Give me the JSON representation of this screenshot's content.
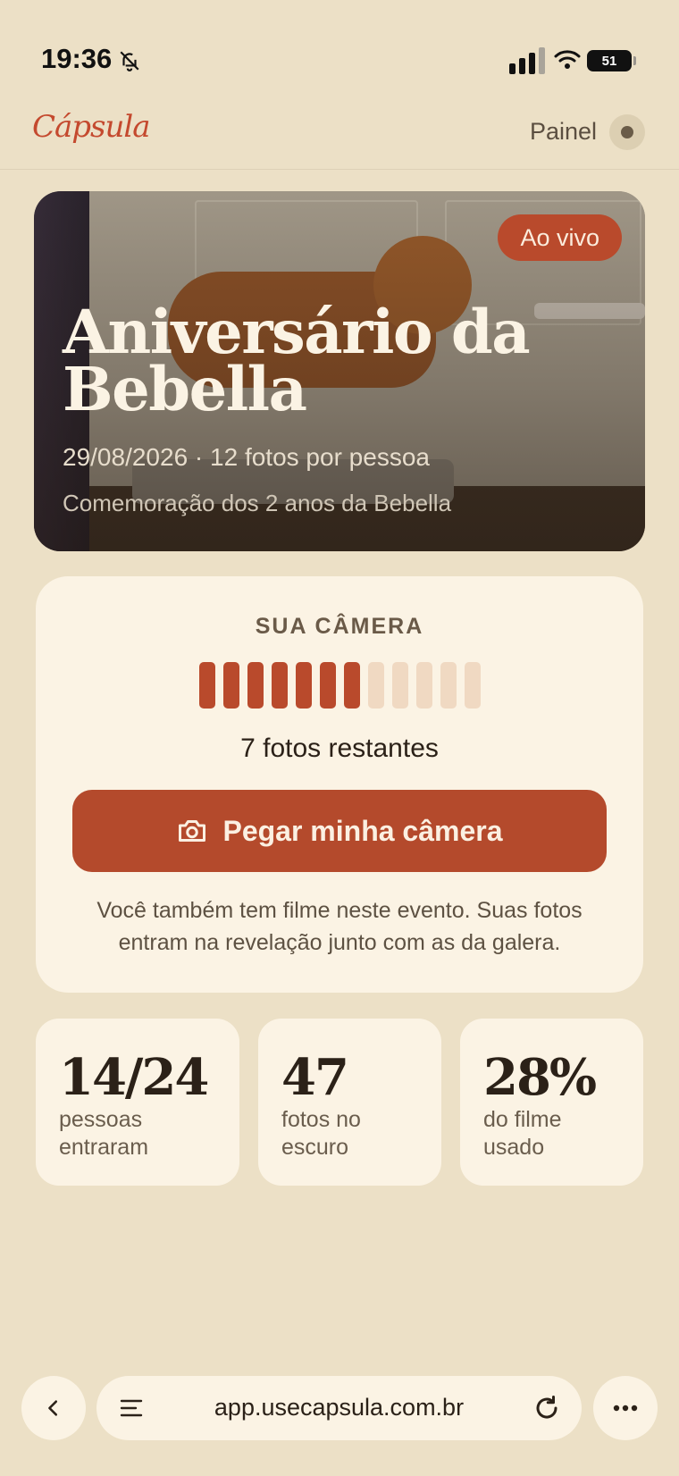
{
  "status_bar": {
    "time": "19:36",
    "battery": "51"
  },
  "header": {
    "logo": "Cápsula",
    "panel_link": "Painel"
  },
  "event": {
    "badge": "Ao vivo",
    "title": "Aniversário da Bebella",
    "meta": "29/08/2026 · 12 fotos por pessoa",
    "description": "Comemoração dos 2 anos da Bebella"
  },
  "camera_card": {
    "label": "SUA CÂMERA",
    "film_total": 12,
    "film_used": 7,
    "remaining_text": "7 fotos restantes",
    "button_label": "Pegar minha câmera",
    "note": "Você também tem filme neste evento. Suas fotos entram na revelação junto com as da galera."
  },
  "stats": [
    {
      "value": "14/24",
      "label": "pessoas entraram"
    },
    {
      "value": "47",
      "label": "fotos no escuro"
    },
    {
      "value": "28%",
      "label": "do filme usado"
    }
  ],
  "browser": {
    "url": "app.usecapsula.com.br"
  },
  "colors": {
    "background": "#ece0c6",
    "accent": "#b94a2c",
    "card": "#fbf3e4",
    "film_empty": "#f0d9c2"
  }
}
